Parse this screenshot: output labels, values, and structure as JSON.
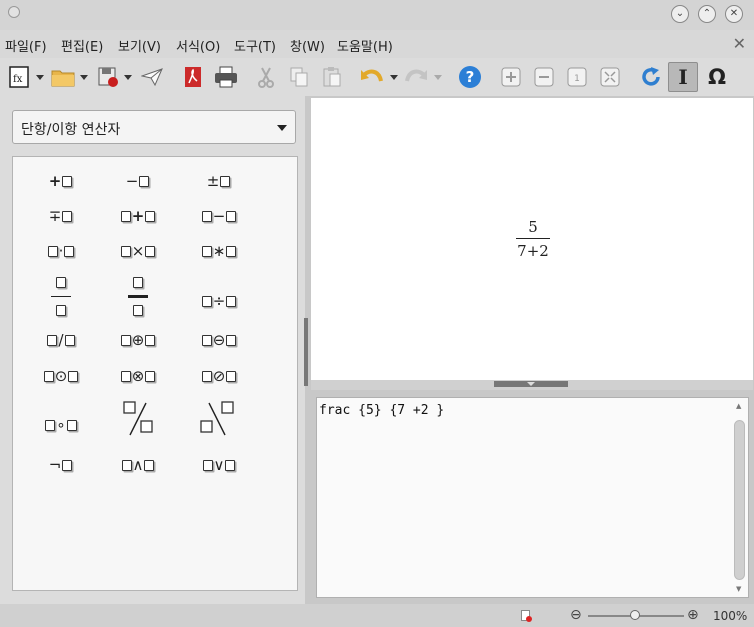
{
  "menubar": {
    "items": [
      "파일(F)",
      "편집(E)",
      "보기(V)",
      "서식(O)",
      "도구(T)",
      "창(W)",
      "도움말(H)"
    ],
    "close_symbol": "✕"
  },
  "toolbar": {
    "help_symbol": "?",
    "cursor_symbol": "I",
    "symbols_symbol": "Ω",
    "icons": [
      "formula-icon",
      "open-folder-icon",
      "save-icon",
      "send-icon",
      "export-pdf-icon",
      "print-icon",
      "cut-icon",
      "copy-icon",
      "paste-icon",
      "undo-icon",
      "redo-icon",
      "help-icon",
      "zoom-in-icon",
      "zoom-out-icon",
      "show-100-icon",
      "show-all-icon",
      "update-icon",
      "formula-cursor-icon",
      "symbols-icon"
    ]
  },
  "elements_panel": {
    "category": "단항/이항 연산자",
    "operators": {
      "plus": "+",
      "minus": "−",
      "plus_minus": "±",
      "minus_plus": "∓",
      "cdot": "·",
      "times": "×",
      "ast": "∗",
      "div": "÷",
      "slash": "/",
      "oplus": "⊕",
      "ominus": "⊖",
      "odot": "⊙",
      "otimes": "⊗",
      "odivide": "⊘",
      "circ": "∘",
      "neg": "¬",
      "and": "∧",
      "or": "∨"
    }
  },
  "preview": {
    "numerator": "5",
    "denominator": "7+2"
  },
  "editor": {
    "text": "frac {5} {7 +2 }"
  },
  "statusbar": {
    "zoom_percent": 100,
    "zoom_label": "100%",
    "zoom_minus": "⊖",
    "zoom_plus": "⊕"
  },
  "colors": {
    "chrome": "#d8d8d8",
    "workspace": "#ffffff",
    "help_blue": "#2c7fd6",
    "pdf_red": "#cc2a2a",
    "undo_yellow": "#e2a92b",
    "update_blue": "#2f7fd0"
  }
}
